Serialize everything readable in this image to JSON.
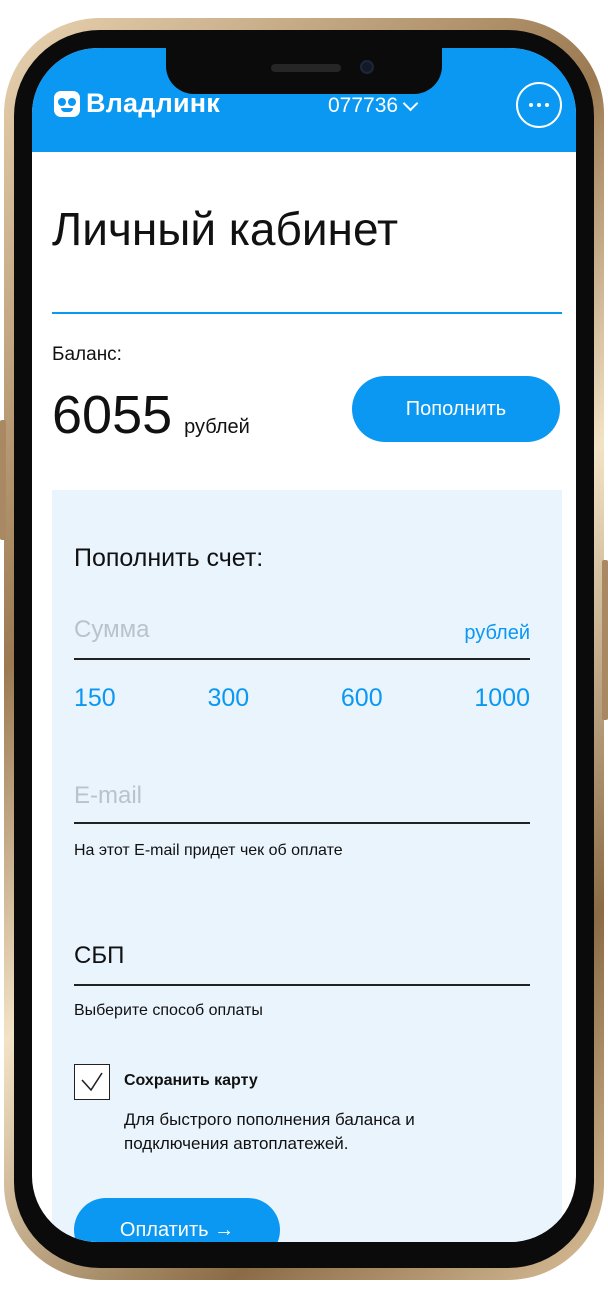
{
  "header": {
    "brand": "Владлинк",
    "account_number": "077736"
  },
  "page": {
    "title": "Личный кабинет"
  },
  "balance": {
    "label": "Баланс:",
    "amount": "6055",
    "unit": "рублей",
    "topup_label": "Пополнить"
  },
  "topup_form": {
    "title": "Пополнить счет:",
    "amount_placeholder": "Сумма",
    "amount_unit": "рублей",
    "quick_amounts": [
      "150",
      "300",
      "600",
      "1000"
    ],
    "email_placeholder": "E-mail",
    "email_hint": "На этот E-mail придет чек об оплате",
    "payment_method": "СБП",
    "payment_method_hint": "Выберите способ оплаты",
    "save_card_label": "Сохранить карту",
    "save_card_checked": true,
    "save_card_description": "Для быстрого пополнения баланса и подключения автоплатежей.",
    "pay_label": "Оплатить →"
  },
  "colors": {
    "accent": "#0a98f2",
    "panel_bg": "#eaf4fd"
  }
}
